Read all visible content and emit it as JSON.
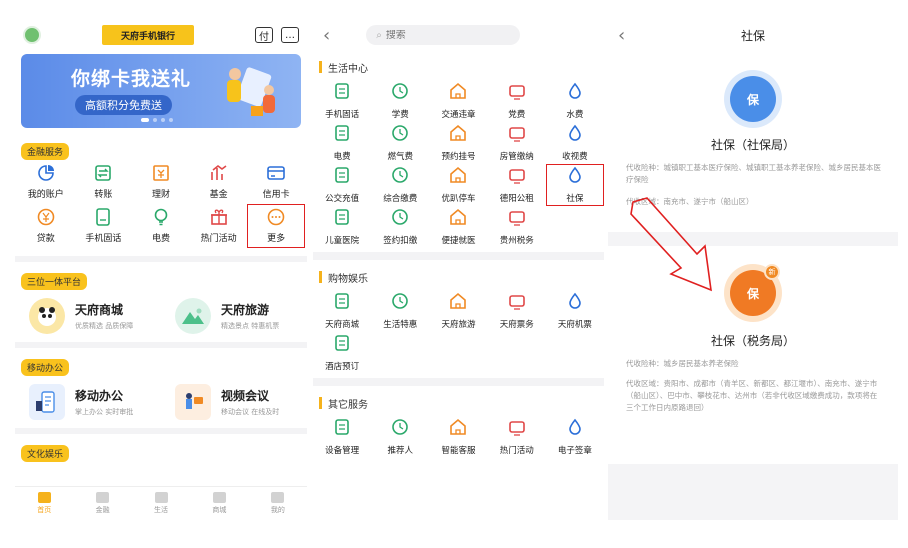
{
  "colors": {
    "accent": "#f5b21c",
    "red_box": "#e02020",
    "banner": "#5b8be8",
    "shebao_blue": "#4a8ee8",
    "shebao_orange": "#f07a24"
  },
  "screen1": {
    "logo": "天府手机银行",
    "topbar_icon_right1": "付",
    "banner": {
      "title": "你绑卡我送礼",
      "subtitle": "高额积分免费送"
    },
    "finance": {
      "tag": "金融服务",
      "items": [
        {
          "label": "我的账户",
          "icon": "pie-icon"
        },
        {
          "label": "转账",
          "icon": "transfer-icon"
        },
        {
          "label": "理财",
          "icon": "finance-icon"
        },
        {
          "label": "基金",
          "icon": "fund-icon"
        },
        {
          "label": "信用卡",
          "icon": "card-icon"
        },
        {
          "label": "贷款",
          "icon": "loan-icon"
        },
        {
          "label": "手机固话",
          "icon": "phone-icon"
        },
        {
          "label": "电费",
          "icon": "bulb-icon"
        },
        {
          "label": "热门活动",
          "icon": "gift-icon"
        },
        {
          "label": "更多",
          "icon": "more-icon"
        }
      ]
    },
    "platform": {
      "tag": "三位一体平台",
      "items": [
        {
          "title": "天府商城",
          "sub": "优质精选 品质保障"
        },
        {
          "title": "天府旅游",
          "sub": "精选景点 特惠机票"
        }
      ]
    },
    "office": {
      "tag": "移动办公",
      "items": [
        {
          "title": "移动办公",
          "sub": "掌上办公 实时审批"
        },
        {
          "title": "视频会议",
          "sub": "移动会议 在线及时"
        }
      ]
    },
    "culture": {
      "tag": "文化娱乐"
    },
    "tabs": [
      "首页",
      "金融",
      "生活",
      "商城",
      "我的"
    ]
  },
  "screen2": {
    "search_placeholder": "搜索",
    "life": {
      "title": "生活中心",
      "items": [
        "手机固话",
        "学费",
        "交通违章",
        "党费",
        "水费",
        "电费",
        "燃气费",
        "预约挂号",
        "房管缴纳",
        "收视费",
        "公交充值",
        "综合缴费",
        "优趴停车",
        "德阳公租",
        "社保",
        "儿童医院",
        "签约扣缴",
        "便捷就医",
        "贵州税务"
      ]
    },
    "shopping": {
      "title": "购物娱乐",
      "items": [
        "天府商城",
        "生活特惠",
        "天府旅游",
        "天府票务",
        "天府机票",
        "酒店预订"
      ]
    },
    "other": {
      "title": "其它服务",
      "items": [
        "设备管理",
        "推荐人",
        "智能客服",
        "热门活动",
        "电子签章"
      ]
    }
  },
  "screen3": {
    "title": "社保",
    "card1": {
      "badge": "保",
      "title": "社保（社保局）",
      "type_line": "代收险种：城镇职工基本医疗保险、城镇职工基本养老保险、城乡居民基本医疗保险",
      "area_line": "代收区域：南充市、遂宁市（船山区）"
    },
    "card2": {
      "badge": "保",
      "new_badge": "新",
      "title": "社保（税务局）",
      "type_line": "代收险种：城乡居民基本养老保险",
      "area_line": "代收区域：贵阳市、成都市（青羊区、新都区、都江堰市）、南充市、遂宁市（船山区）、巴中市、攀枝花市、达州市（若非代收区域缴费成功，款项将在三个工作日内原路退回）"
    }
  }
}
